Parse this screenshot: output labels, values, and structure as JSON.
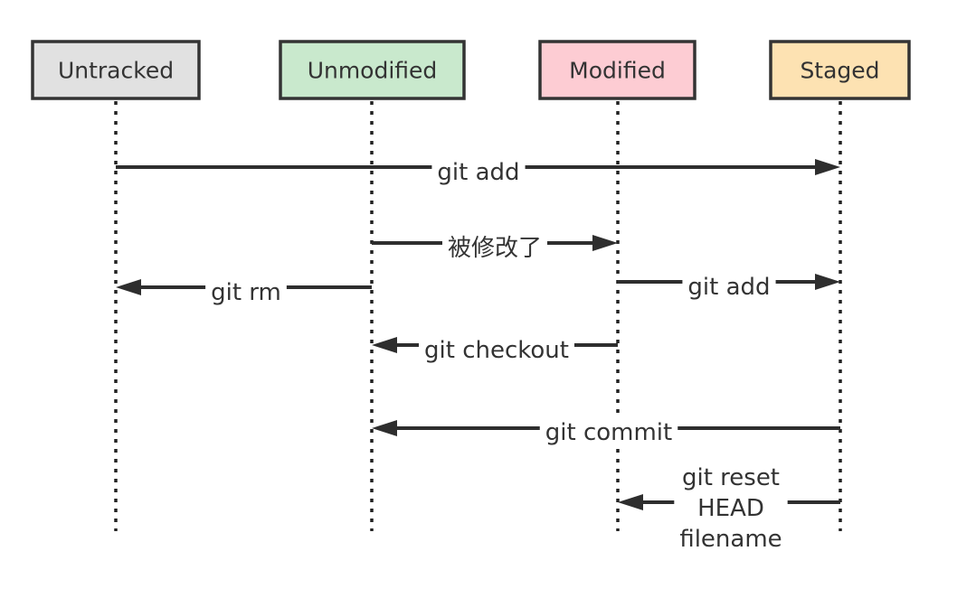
{
  "states": [
    {
      "id": "untracked",
      "label": "Untracked",
      "fill": "#e1e1e1"
    },
    {
      "id": "unmodified",
      "label": "Unmodified",
      "fill": "#c9e9cd"
    },
    {
      "id": "modified",
      "label": "Modified",
      "fill": "#fdccd3"
    },
    {
      "id": "staged",
      "label": "Staged",
      "fill": "#fde2b2"
    }
  ],
  "transitions": [
    {
      "id": "git-add-untracked",
      "from": "untracked",
      "to": "staged",
      "lines": [
        "git add"
      ]
    },
    {
      "id": "edited",
      "from": "unmodified",
      "to": "modified",
      "lines": [
        "被修改了"
      ]
    },
    {
      "id": "git-rm",
      "from": "unmodified",
      "to": "untracked",
      "lines": [
        "git rm"
      ]
    },
    {
      "id": "git-add-modified",
      "from": "modified",
      "to": "staged",
      "lines": [
        "git add"
      ]
    },
    {
      "id": "git-checkout",
      "from": "modified",
      "to": "unmodified",
      "lines": [
        "git checkout"
      ]
    },
    {
      "id": "git-commit",
      "from": "staged",
      "to": "unmodified",
      "lines": [
        "git commit"
      ]
    },
    {
      "id": "git-reset",
      "from": "staged",
      "to": "modified",
      "lines": [
        "git reset",
        "HEAD",
        "filename"
      ]
    }
  ],
  "colors": {
    "border": "#333333",
    "line": "#2e2e2e",
    "text": "#333333"
  }
}
